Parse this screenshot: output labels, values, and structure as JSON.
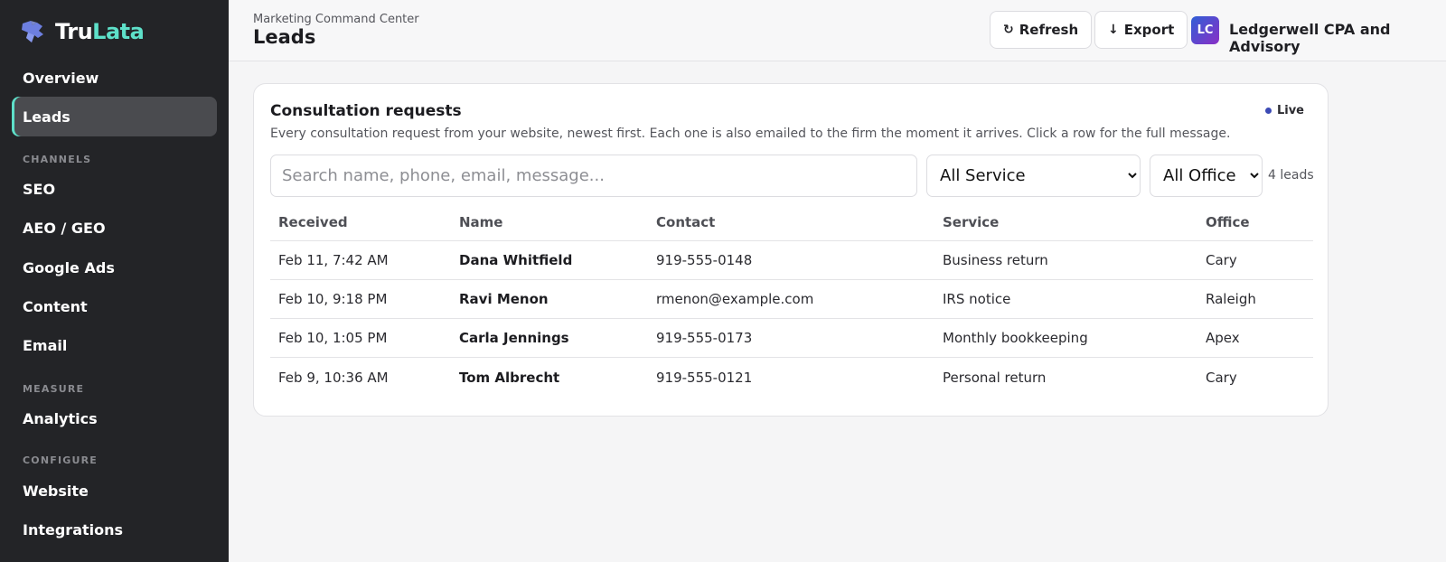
{
  "brand": {
    "name_part1": "Tru",
    "name_part2": "Lata"
  },
  "sidebar": {
    "items": [
      {
        "label": "Overview"
      },
      {
        "label": "Leads",
        "active": true
      },
      {
        "label": "SEO"
      },
      {
        "label": "AEO / GEO"
      },
      {
        "label": "Google Ads"
      },
      {
        "label": "Content"
      },
      {
        "label": "Email"
      },
      {
        "label": "Analytics"
      },
      {
        "label": "Website"
      },
      {
        "label": "Integrations"
      }
    ],
    "sections": {
      "channels": "CHANNELS",
      "measure": "MEASURE",
      "configure": "CONFIGURE"
    }
  },
  "header": {
    "breadcrumb": "Marketing Command Center",
    "title": "Leads",
    "refresh_label": "Refresh",
    "export_label": "Export",
    "avatar_initials": "LC",
    "org_name": "Ledgerwell CPA and Advisory"
  },
  "card": {
    "title": "Consultation requests",
    "live_label": "Live",
    "description": "Every consultation request from your website, newest first. Each one is also emailed to the firm the moment it arrives. Click a row for the full message.",
    "search_placeholder": "Search name, phone, email, message...",
    "service_filter": "All Service",
    "office_filter": "All Office",
    "lead_count": "4 leads"
  },
  "table": {
    "headers": {
      "received": "Received",
      "name": "Name",
      "contact": "Contact",
      "service": "Service",
      "office": "Office"
    },
    "rows": [
      {
        "received": "Feb 11, 7:42 AM",
        "name": "Dana Whitfield",
        "contact": "919-555-0148",
        "service": "Business return",
        "office": "Cary"
      },
      {
        "received": "Feb 10, 9:18 PM",
        "name": "Ravi Menon",
        "contact": "rmenon@example.com",
        "service": "IRS notice",
        "office": "Raleigh"
      },
      {
        "received": "Feb 10, 1:05 PM",
        "name": "Carla Jennings",
        "contact": "919-555-0173",
        "service": "Monthly bookkeeping",
        "office": "Apex"
      },
      {
        "received": "Feb 9, 10:36 AM",
        "name": "Tom Albrecht",
        "contact": "919-555-0121",
        "service": "Personal return",
        "office": "Cary"
      }
    ]
  },
  "colors": {
    "sidebar_bg": "#232427",
    "accent_teal": "#5ee0c9",
    "live_dot": "#3c4bb5"
  },
  "icons": {
    "refresh": "refresh-icon",
    "export": "arrow-down-icon",
    "logo": "puzzle-logo-icon"
  }
}
